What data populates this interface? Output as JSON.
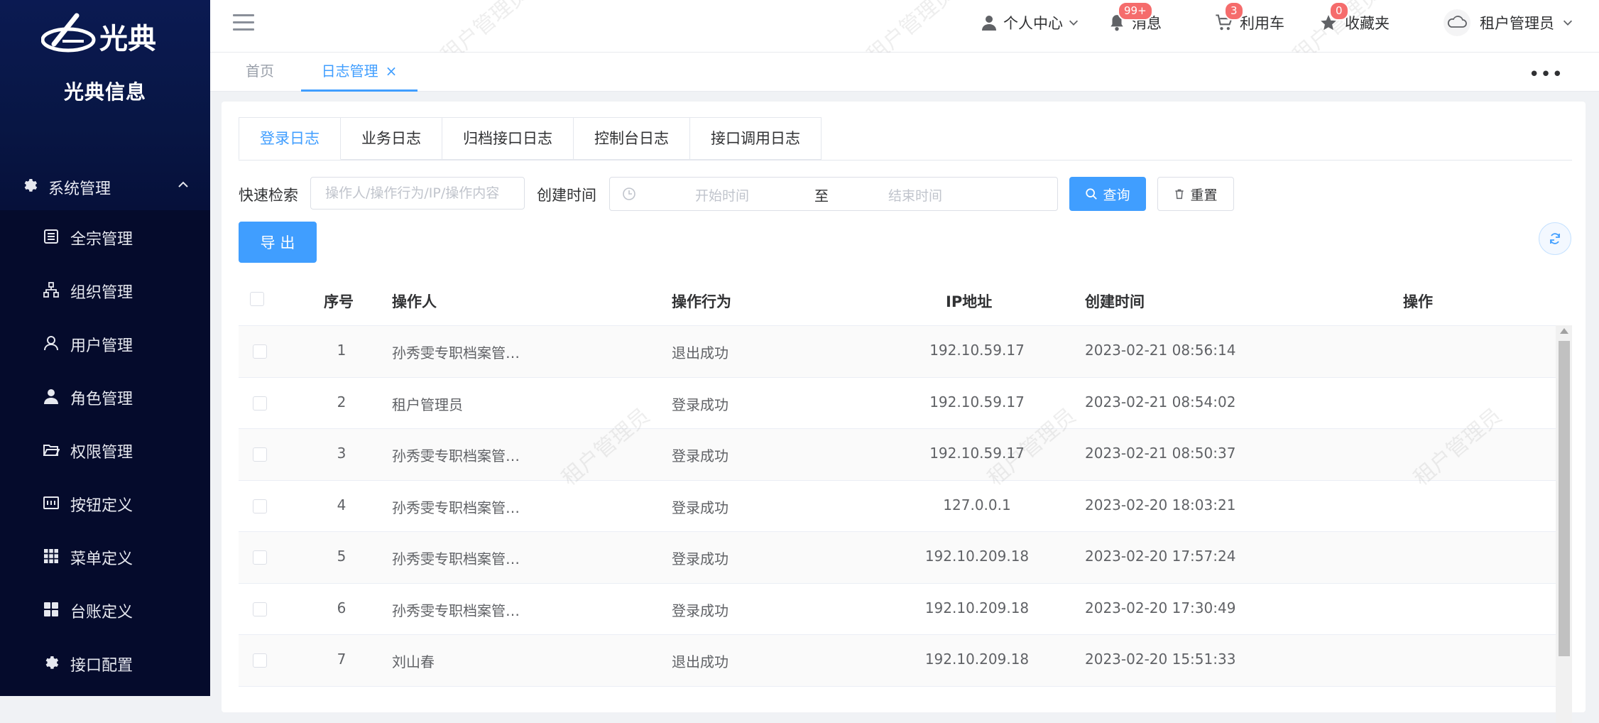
{
  "brand": {
    "logo_text": "光典",
    "name": "光典信息"
  },
  "sidebar": {
    "group": {
      "label": "系统管理",
      "icon": "gear-icon"
    },
    "items": [
      {
        "label": "全宗管理",
        "icon": "document-icon"
      },
      {
        "label": "组织管理",
        "icon": "org-tree-icon"
      },
      {
        "label": "用户管理",
        "icon": "user-outline-icon"
      },
      {
        "label": "角色管理",
        "icon": "user-filled-icon"
      },
      {
        "label": "权限管理",
        "icon": "folder-open-icon"
      },
      {
        "label": "按钮定义",
        "icon": "button-box-icon"
      },
      {
        "label": "菜单定义",
        "icon": "grid-icon"
      },
      {
        "label": "台账定义",
        "icon": "tiles-icon"
      },
      {
        "label": "接口配置",
        "icon": "gear-icon"
      }
    ]
  },
  "header": {
    "personal_center": "个人中心",
    "messages": {
      "label": "消息",
      "badge": "99+"
    },
    "cart": {
      "label": "利用车",
      "badge": "3"
    },
    "favorites": {
      "label": "收藏夹",
      "badge": "0"
    },
    "user": "租户管理员",
    "watermark": "租户管理员"
  },
  "tags": {
    "home": "首页",
    "active": "日志管理",
    "close": "×",
    "more": "•••"
  },
  "subtabs": [
    "登录日志",
    "业务日志",
    "归档接口日志",
    "控制台日志",
    "接口调用日志"
  ],
  "filters": {
    "quick_search_label": "快速检索",
    "quick_search_placeholder": "操作人/操作行为/IP/操作内容",
    "created_label": "创建时间",
    "start_placeholder": "开始时间",
    "range_sep": "至",
    "end_placeholder": "结束时间",
    "query_btn": "查询",
    "reset_btn": "重置",
    "export_btn": "导 出"
  },
  "table": {
    "columns": [
      "序号",
      "操作人",
      "操作行为",
      "IP地址",
      "创建时间",
      "操作"
    ],
    "rows": [
      {
        "no": "1",
        "operator": "孙秀雯专职档案管…",
        "action": "退出成功",
        "ip": "192.10.59.17",
        "time": "2023-02-21 08:56:14"
      },
      {
        "no": "2",
        "operator": "租户管理员",
        "action": "登录成功",
        "ip": "192.10.59.17",
        "time": "2023-02-21 08:54:02"
      },
      {
        "no": "3",
        "operator": "孙秀雯专职档案管…",
        "action": "登录成功",
        "ip": "192.10.59.17",
        "time": "2023-02-21 08:50:37"
      },
      {
        "no": "4",
        "operator": "孙秀雯专职档案管…",
        "action": "登录成功",
        "ip": "127.0.0.1",
        "time": "2023-02-20 18:03:21"
      },
      {
        "no": "5",
        "operator": "孙秀雯专职档案管…",
        "action": "登录成功",
        "ip": "192.10.209.18",
        "time": "2023-02-20 17:57:24"
      },
      {
        "no": "6",
        "operator": "孙秀雯专职档案管…",
        "action": "登录成功",
        "ip": "192.10.209.18",
        "time": "2023-02-20 17:30:49"
      },
      {
        "no": "7",
        "operator": "刘山春",
        "action": "退出成功",
        "ip": "192.10.209.18",
        "time": "2023-02-20 15:51:33"
      }
    ]
  },
  "colors": {
    "primary": "#409eff",
    "sidebar_bg": "#050b2c",
    "badge": "#f56c6c"
  }
}
